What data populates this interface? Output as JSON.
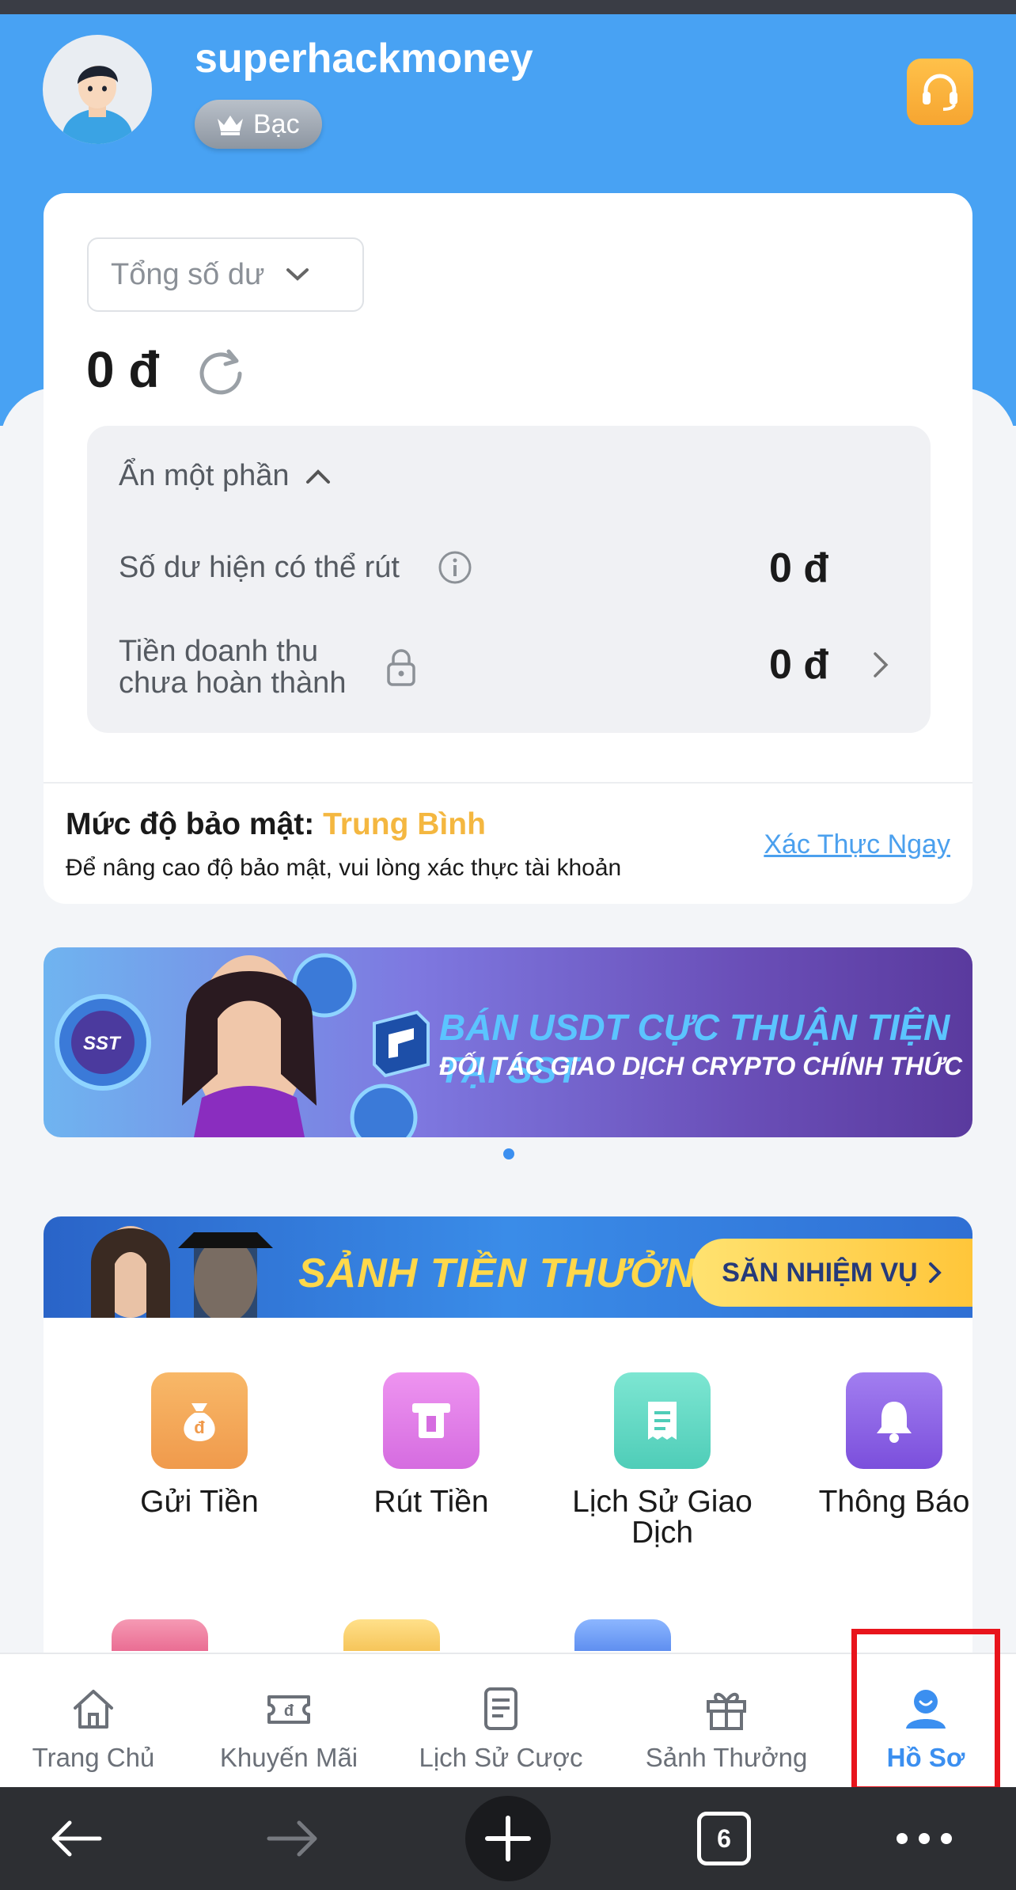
{
  "profile": {
    "username": "superhackmoney",
    "rank": "Bạc"
  },
  "balance": {
    "selector_label": "Tổng số dư",
    "amount": "0 đ",
    "collapse_label": "Ẩn một phần",
    "withdrawable_label": "Số dư hiện có thể rút",
    "withdrawable_value": "0 đ",
    "pending_label_line1": "Tiền doanh thu",
    "pending_label_line2": "chưa hoàn thành",
    "pending_value": "0 đ"
  },
  "security": {
    "title": "Mức độ bảo mật:",
    "level": "Trung Bình",
    "subtitle": "Để nâng cao độ bảo mật, vui lòng xác thực tài khoản",
    "verify_link": "Xác Thực Ngay"
  },
  "promo_banner": {
    "title": "BÁN USDT CỰC THUẬN TIỆN TẠI SST",
    "subtitle": "ĐỐI TÁC GIAO DỊCH CRYPTO CHÍNH THỨC",
    "badge": "SST"
  },
  "reward_banner": {
    "title": "SẢNH TIỀN THƯỞNG",
    "cta": "SĂN NHIỆM VỤ"
  },
  "grid": [
    {
      "label": "Gửi Tiền",
      "icon": "deposit-icon",
      "color": "#f4a45a"
    },
    {
      "label": "Rút Tiền",
      "icon": "withdraw-icon",
      "color": "#e07ee8"
    },
    {
      "label": "Lịch Sử Giao Dịch",
      "icon": "transaction-history-icon",
      "color": "#5fd6c3"
    },
    {
      "label": "Thông Báo",
      "icon": "bell-icon",
      "color": "#8f62e8"
    }
  ],
  "tabbar": [
    {
      "label": "Trang Chủ",
      "icon": "home-icon"
    },
    {
      "label": "Khuyến Mãi",
      "icon": "promotion-icon"
    },
    {
      "label": "Lịch Sử Cược",
      "icon": "bet-history-icon"
    },
    {
      "label": "Sảnh Thưởng",
      "icon": "gift-icon"
    },
    {
      "label": "Hồ Sơ",
      "icon": "profile-icon",
      "active": true
    }
  ],
  "browser": {
    "tab_count": "6"
  },
  "colors": {
    "primary": "#48a2f3",
    "accent": "#3b8ff0",
    "security_level": "#f4b740",
    "highlight": "#e8141c"
  }
}
